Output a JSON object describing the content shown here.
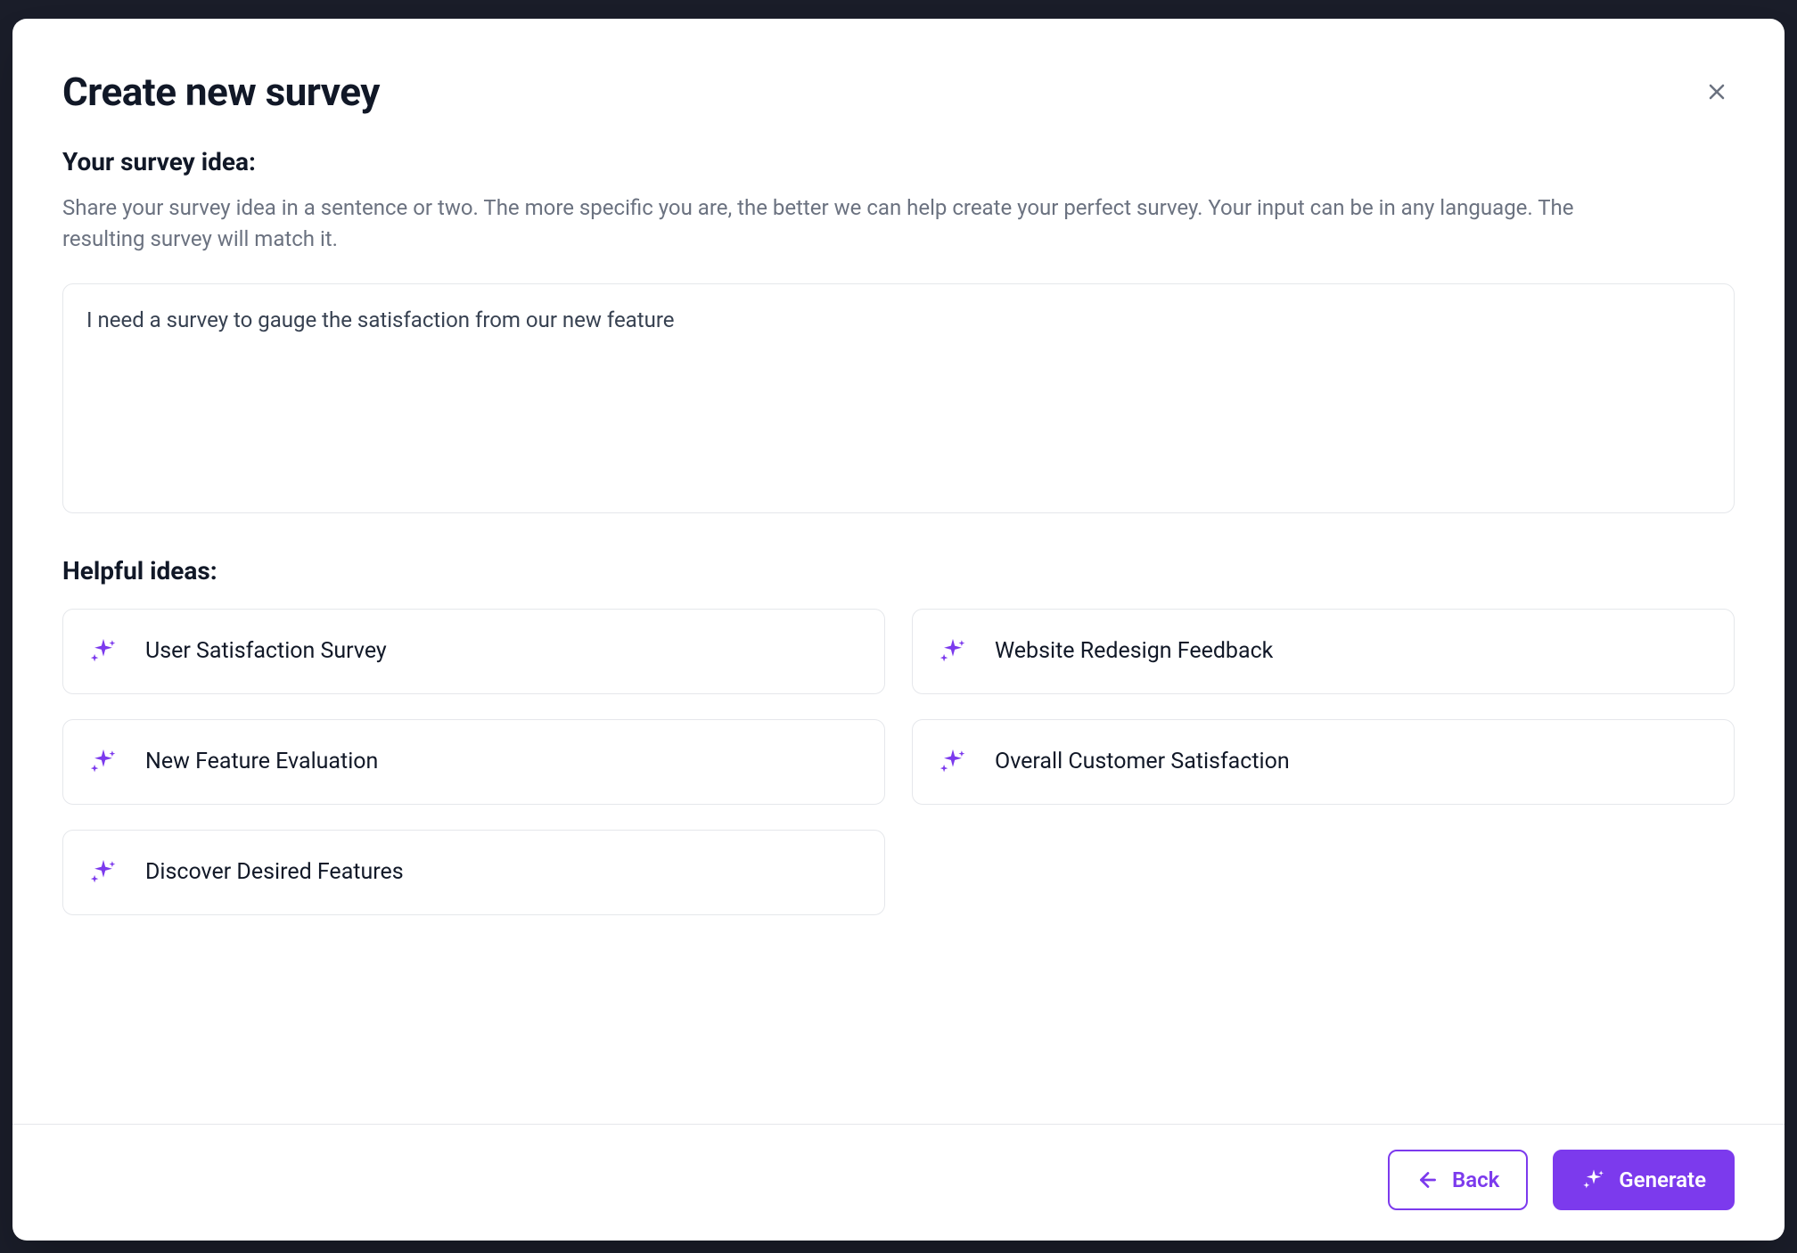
{
  "modal": {
    "title": "Create new survey",
    "idea_section": {
      "label": "Your survey idea:",
      "hint": "Share your survey idea in a sentence or two. The more specific you are, the better we can help create your perfect survey. Your input can be in any language. The resulting survey will match it.",
      "value": "I need a survey to gauge the satisfaction from our new feature"
    },
    "helpful_section": {
      "label": "Helpful ideas:",
      "ideas": [
        "User Satisfaction Survey",
        "Website Redesign Feedback",
        "New Feature Evaluation",
        "Overall Customer Satisfaction",
        "Discover Desired Features"
      ]
    },
    "footer": {
      "back_label": "Back",
      "generate_label": "Generate"
    }
  },
  "colors": {
    "accent": "#7c3aed",
    "text_primary": "#111827",
    "text_secondary": "#6b7280",
    "border": "#e5e7eb"
  }
}
